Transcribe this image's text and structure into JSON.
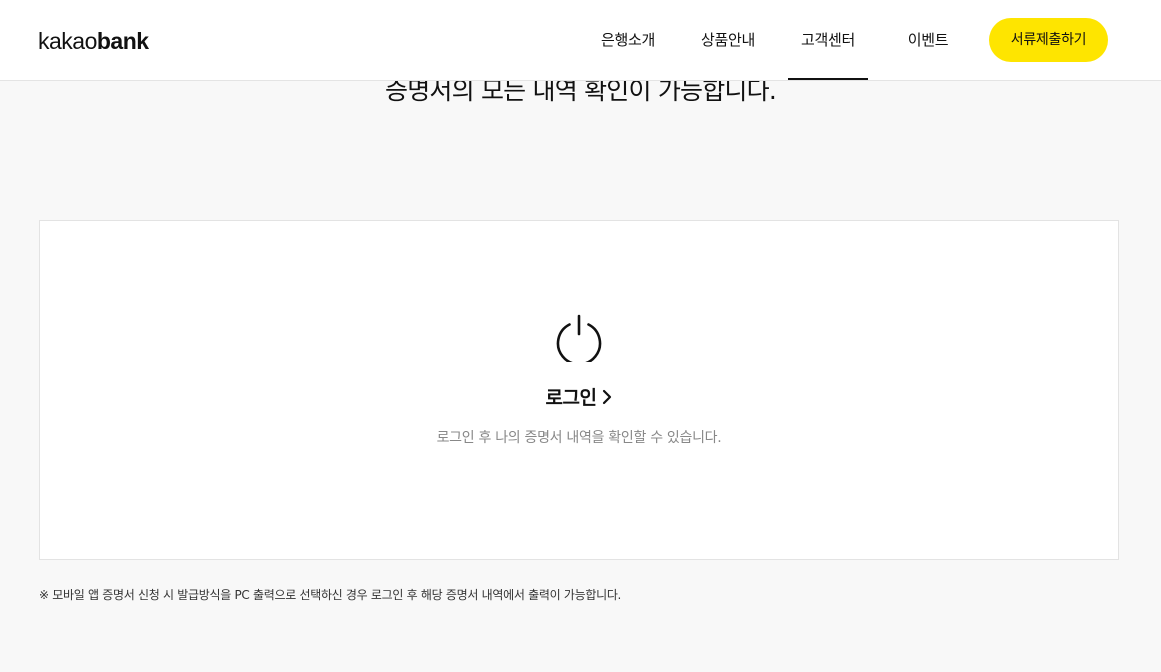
{
  "header": {
    "logo": {
      "part1": "kakao",
      "part2": "bank"
    },
    "nav": [
      {
        "label": "은행소개",
        "active": false
      },
      {
        "label": "상품안내",
        "active": false
      },
      {
        "label": "고객센터",
        "active": true
      },
      {
        "label": "이벤트",
        "active": false
      }
    ],
    "cta_label": "서류제출하기",
    "accent_color": "#fee500"
  },
  "main": {
    "headline": "증명서의 모든 내역 확인이 가능합니다.",
    "panel": {
      "icon": "power-icon",
      "login_label": "로그인",
      "description": "로그인 후 나의 증명서 내역을 확인할 수 있습니다."
    },
    "footnote": "※ 모바일 앱 증명서 신청 시 발급방식을 PC 출력으로 선택하신 경우 로그인 후 해당 증명서 내역에서 출력이 가능합니다."
  }
}
